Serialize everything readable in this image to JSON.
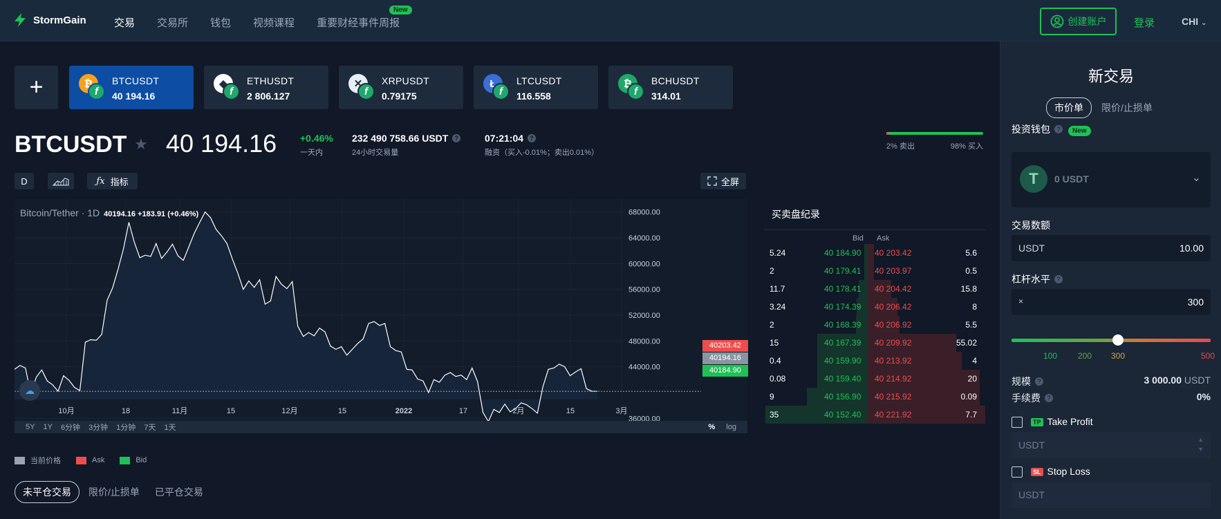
{
  "brand": {
    "name": "StormGain"
  },
  "nav": {
    "items": [
      "交易",
      "交易所",
      "钱包",
      "视频课程",
      "重要财经事件周报"
    ],
    "new_badge": "New"
  },
  "header_actions": {
    "register": "创建账户",
    "login": "登录",
    "lang": "CHI"
  },
  "tickers": [
    {
      "symbol": "BTCUSDT",
      "price": "40 194.16",
      "icon": "bitcoin-icon",
      "color": "#f7a21b"
    },
    {
      "symbol": "ETHUSDT",
      "price": "2 806.127",
      "icon": "ethereum-icon",
      "color": "#ffffff"
    },
    {
      "symbol": "XRPUSDT",
      "price": "0.79175",
      "icon": "xrp-icon",
      "color": "#e8eef5"
    },
    {
      "symbol": "LTCUSDT",
      "price": "116.558",
      "icon": "litecoin-icon",
      "color": "#3a6fd8"
    },
    {
      "symbol": "BCHUSDT",
      "price": "314.01",
      "icon": "bitcoin-cash-icon",
      "color": "#1fa86b"
    }
  ],
  "instrument": {
    "symbol": "BTCUSDT",
    "price": "40 194.16",
    "change": "+0.46%",
    "change_label": "一天内",
    "volume": "232 490 758.66 USDT",
    "volume_label": "24小时交易量",
    "time": "07:21:04",
    "funding_label": "融资（买入-0.01%；卖出0.01%）"
  },
  "sentiment": {
    "sell": "2% 卖出",
    "buy": "98% 买入",
    "sell_pct": 2
  },
  "chart_toolbar": {
    "interval": "D",
    "indicators": "指标",
    "fullscreen": "全屏"
  },
  "chart": {
    "title": "Bitcoin/Tether · 1D",
    "ohlc": "40194.16  +183.91 (+0.46%)",
    "ask_tag": "40203.42",
    "last_tag": "40194.16",
    "bid_tag": "40184.90",
    "ranges": [
      "5Y",
      "1Y",
      "6分钟",
      "3分钟",
      "1分钟",
      "7天",
      "1天"
    ],
    "percent": "%",
    "log": "log",
    "legend": [
      {
        "label": "当前价格",
        "color": "#9aa3af"
      },
      {
        "label": "Ask",
        "color": "#ef4d4d"
      },
      {
        "label": "Bid",
        "color": "#1fc157"
      }
    ]
  },
  "chart_data": {
    "type": "line",
    "title": "Bitcoin/Tether · 1D",
    "x_ticks": [
      "10月",
      "18",
      "11月",
      "15",
      "12月",
      "15",
      "2022",
      "17",
      "2月",
      "15",
      "3月"
    ],
    "y_ticks": [
      "68000.00",
      "64000.00",
      "60000.00",
      "56000.00",
      "52000.00",
      "48000.00",
      "44000.00",
      "36000.00"
    ],
    "ylim": [
      34000,
      70000
    ],
    "series": [
      {
        "values": [
          43600,
          44200,
          43800,
          39800,
          42400,
          43500,
          41800,
          41200,
          40200,
          42600,
          41900,
          40800,
          40300,
          47800,
          48200,
          48100,
          49000,
          54300,
          56200,
          59100,
          62300,
          66400,
          63300,
          60900,
          61300,
          61100,
          63100,
          60800,
          61800,
          63000,
          61200,
          60500,
          62600,
          64700,
          66400,
          68000,
          67100,
          65300,
          64300,
          63100,
          60700,
          58500,
          56000,
          57300,
          56300,
          57500,
          53700,
          54200,
          58000,
          56800,
          56100,
          57200,
          50300,
          48700,
          49300,
          48800,
          50000,
          49400,
          47200,
          46700,
          47100,
          45800,
          46700,
          47600,
          48300,
          50700,
          51000,
          50400,
          50700,
          47100,
          46500,
          46300,
          43600,
          43500,
          42100,
          41800,
          40000,
          42000,
          41600,
          42700,
          43100,
          42500,
          42700,
          42000,
          43800,
          41700,
          36900,
          35500,
          37400,
          36900,
          38200,
          37000,
          37500,
          38400,
          38100,
          37500,
          36800,
          40900,
          43600,
          43800,
          44400,
          44000,
          42600,
          43200,
          43700,
          40600,
          40200,
          40194
        ]
      }
    ]
  },
  "orderbook": {
    "title": "买卖盘纪录",
    "bid_label": "Bid",
    "ask_label": "Ask",
    "rows": [
      {
        "bid_vol": "5.24",
        "bid": "40 184.90",
        "ask": "40 203.42",
        "ask_vol": "5.6",
        "bid_depth": 0.05,
        "ask_depth": 0.05
      },
      {
        "bid_vol": "2",
        "bid": "40 179.41",
        "ask": "40 203.97",
        "ask_vol": "0.5",
        "bid_depth": 0.05,
        "ask_depth": 0.05
      },
      {
        "bid_vol": "11.7",
        "bid": "40 178.41",
        "ask": "40 204.42",
        "ask_vol": "15.8",
        "bid_depth": 0.1,
        "ask_depth": 0.2
      },
      {
        "bid_vol": "3.24",
        "bid": "40 174.39",
        "ask": "40 206.42",
        "ask_vol": "8",
        "bid_depth": 0.12,
        "ask_depth": 0.25
      },
      {
        "bid_vol": "2",
        "bid": "40 168.39",
        "ask": "40 206.92",
        "ask_vol": "5.5",
        "bid_depth": 0.13,
        "ask_depth": 0.27
      },
      {
        "bid_vol": "15",
        "bid": "40 167.39",
        "ask": "40 209.92",
        "ask_vol": "55.02",
        "bid_depth": 0.5,
        "ask_depth": 0.75
      },
      {
        "bid_vol": "0.4",
        "bid": "40 159.90",
        "ask": "40 213.92",
        "ask_vol": "4",
        "bid_depth": 0.5,
        "ask_depth": 0.8
      },
      {
        "bid_vol": "0.08",
        "bid": "40 159.40",
        "ask": "40 214.92",
        "ask_vol": "20",
        "bid_depth": 0.5,
        "ask_depth": 0.95
      },
      {
        "bid_vol": "9",
        "bid": "40 156.90",
        "ask": "40 215.92",
        "ask_vol": "0.09",
        "bid_depth": 0.6,
        "ask_depth": 0.95
      },
      {
        "bid_vol": "35",
        "bid": "40 152.40",
        "ask": "40 221.92",
        "ask_vol": "7.7",
        "bid_depth": 1.0,
        "ask_depth": 1.0
      }
    ]
  },
  "trade_tabs": [
    "未平仓交易",
    "限价/止损单",
    "已平仓交易"
  ],
  "side": {
    "title": "新交易",
    "tabs": [
      "市价单",
      "限价/止损单"
    ],
    "wallet_label": "投资钱包",
    "wallet_new": "New",
    "wallet_value": "0 USDT",
    "amount_label": "交易数额",
    "amount_currency": "USDT",
    "amount_value": "10.00",
    "leverage_label": "杠杆水平",
    "leverage_x": "×",
    "leverage_value": "300",
    "leverage_marks": [
      "100",
      "200",
      "300",
      "500"
    ],
    "size_label": "规模",
    "size_value": "3 000.00",
    "size_unit": "USDT",
    "fee_label": "手续费",
    "fee_value": "0%",
    "tp_badge": "TP",
    "tp_label": "Take Profit",
    "tp_currency": "USDT",
    "sl_badge": "SL",
    "sl_label": "Stop Loss",
    "sl_currency": "USDT"
  }
}
